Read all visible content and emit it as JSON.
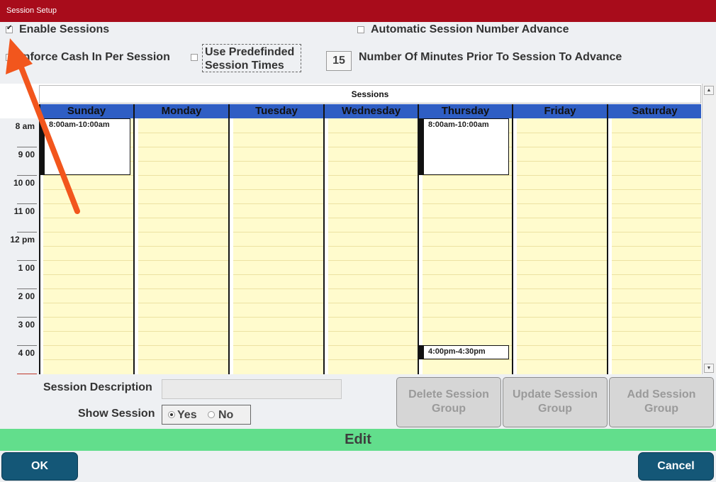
{
  "window": {
    "title": "Session Setup"
  },
  "options": {
    "enable_sessions": {
      "label": "Enable Sessions",
      "checked": true
    },
    "auto_advance": {
      "label": "Automatic Session Number Advance",
      "checked": false
    },
    "enforce_cash": {
      "label": "Enforce Cash In Per Session",
      "checked": false
    },
    "predefined": {
      "label_line1": "Use Predefinded",
      "label_line2": "Session Times",
      "checked": false
    },
    "minutes_prior": {
      "value": "15",
      "label": "Number Of Minutes Prior To Session To Advance"
    }
  },
  "calendar": {
    "header": "Sessions",
    "days": [
      "Sunday",
      "Monday",
      "Tuesday",
      "Wednesday",
      "Thursday",
      "Friday",
      "Saturday"
    ],
    "times": [
      "8 am",
      "9 00",
      "10 00",
      "11 00",
      "12 pm",
      "1 00",
      "2 00",
      "3 00",
      "4 00"
    ],
    "events": [
      {
        "day": "Sunday",
        "label": "8:00am-10:00am"
      },
      {
        "day": "Thursday",
        "label": "8:00am-10:00am"
      },
      {
        "day": "Thursday",
        "label": "4:00pm-4:30pm"
      }
    ]
  },
  "form": {
    "description_label": "Session Description",
    "description_value": "",
    "show_label": "Show Session",
    "yes_label": "Yes",
    "no_label": "No",
    "show_selected": "Yes"
  },
  "buttons": {
    "delete_line1": "Delete Session",
    "delete_line2": "Group",
    "update_line1": "Update Session",
    "update_line2": "Group",
    "add_line1": "Add Session",
    "add_line2": "Group",
    "ok": "OK",
    "cancel": "Cancel"
  },
  "mode_label": "Edit",
  "colors": {
    "title_bar": "#a80c1b",
    "day_header": "#2f5ec4",
    "calendar_body": "#fffbcd",
    "edit_bar": "#62de8c",
    "primary_button": "#145777",
    "annotation_arrow": "#f2561d"
  }
}
